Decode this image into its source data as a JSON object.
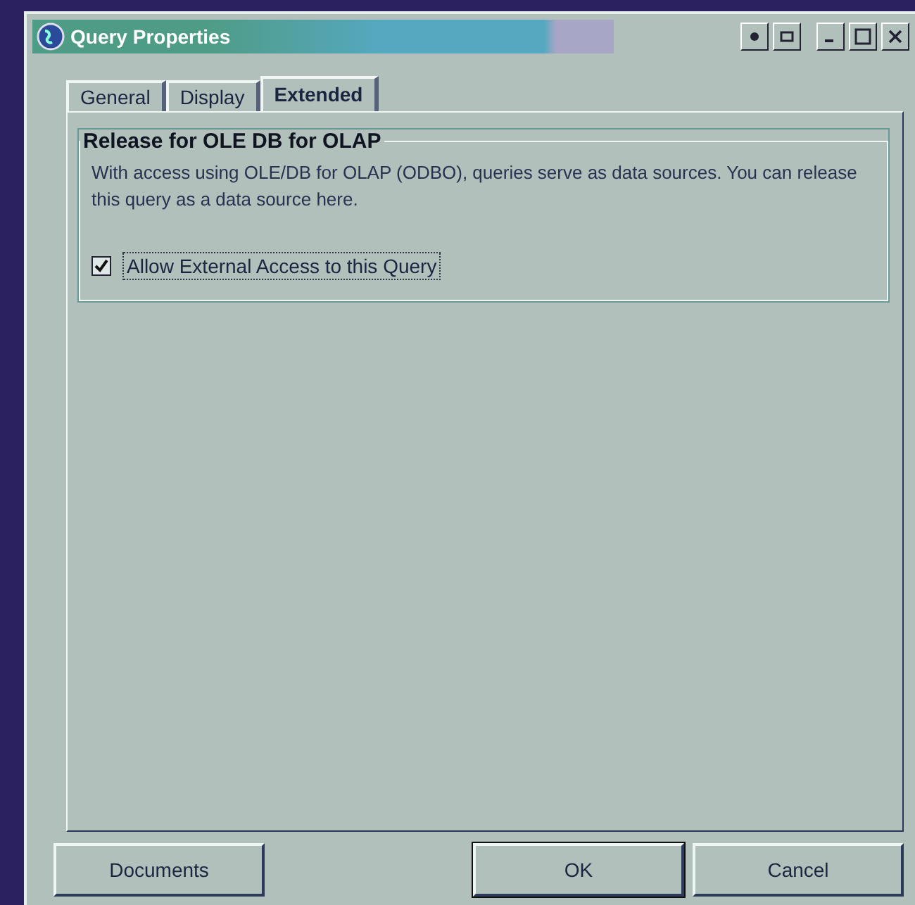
{
  "window": {
    "title": "Query Properties"
  },
  "tabs": [
    {
      "label": "General",
      "selected": false
    },
    {
      "label": "Display",
      "selected": false
    },
    {
      "label": "Extended",
      "selected": true
    }
  ],
  "group": {
    "title": "Release for OLE DB for OLAP",
    "description": "With access using OLE/DB for OLAP (ODBO), queries serve as data sources. You can release this query as a data source here.",
    "checkbox": {
      "label": "Allow External Access to this Query",
      "checked": true
    }
  },
  "buttons": [
    {
      "label": "Documents",
      "kind": "left",
      "default": false
    },
    {
      "label": "OK",
      "kind": "right",
      "default": true
    },
    {
      "label": "Cancel",
      "kind": "right",
      "default": false
    }
  ]
}
